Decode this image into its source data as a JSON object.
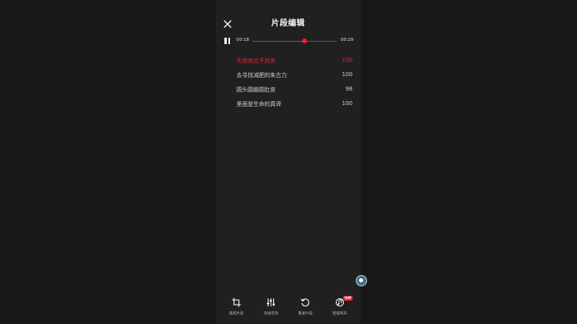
{
  "header": {
    "title": "片段编辑"
  },
  "player": {
    "current_time": "00:18",
    "total_time": "00:29",
    "progress": 0.62
  },
  "lyrics": [
    {
      "text": "天南地北不放弃",
      "score": "100",
      "active": true
    },
    {
      "text": "去寻找减肥的朱古力",
      "score": "100",
      "active": false
    },
    {
      "text": "圆头圆脑圆肚皮",
      "score": "98",
      "active": false
    },
    {
      "text": "里面是生命的真谛",
      "score": "100",
      "active": false
    }
  ],
  "toolbar": {
    "items": [
      {
        "label": "裁剪片段",
        "icon": "crop-icon"
      },
      {
        "label": "添加音效",
        "icon": "sliders-icon"
      },
      {
        "label": "重录片段",
        "icon": "rerecord-icon"
      },
      {
        "label": "智能和声",
        "icon": "harmony-icon",
        "badge": "VIP"
      }
    ]
  },
  "colors": {
    "accent": "#e0262d",
    "background": "#202020"
  }
}
